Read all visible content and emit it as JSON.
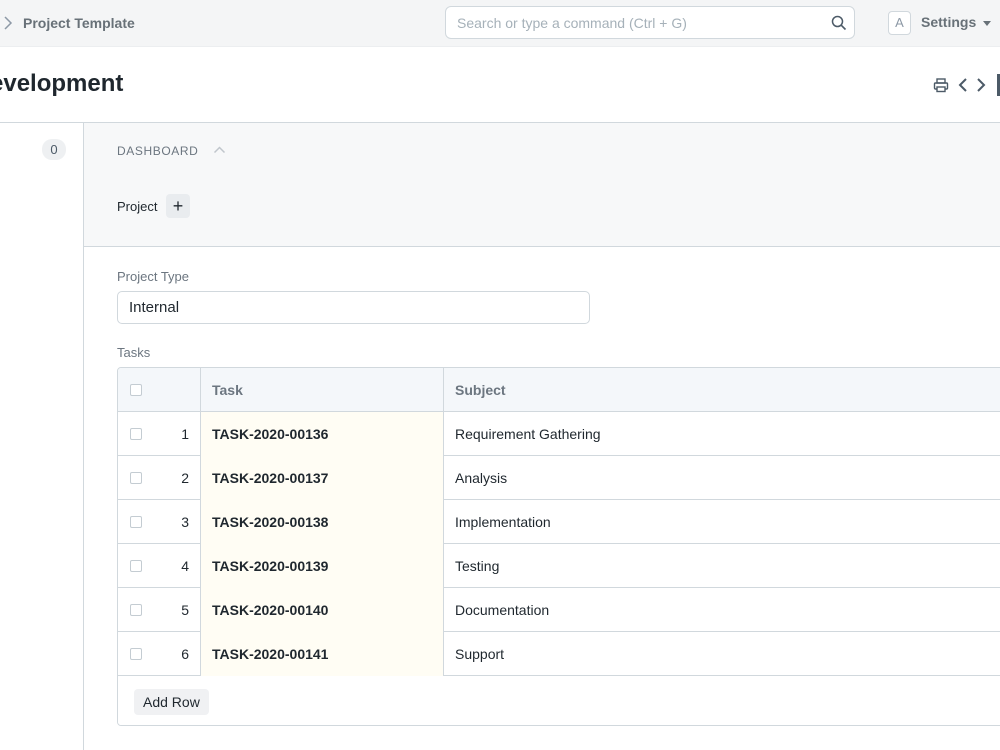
{
  "navbar": {
    "breadcrumb": "Project Template",
    "search_placeholder": "Search or type a command (Ctrl + G)",
    "avatar_initial": "A",
    "settings_label": "Settings"
  },
  "page": {
    "title": "evelopment"
  },
  "sidebar": {
    "badge_count": "0"
  },
  "dashboard": {
    "label": "DASHBOARD",
    "project_link": "Project",
    "add_symbol": "+"
  },
  "form": {
    "project_type_label": "Project Type",
    "project_type_value": "Internal",
    "tasks_label": "Tasks"
  },
  "grid": {
    "columns": [
      "Task",
      "Subject"
    ],
    "rows": [
      {
        "idx": "1",
        "task": "TASK-2020-00136",
        "subject": "Requirement Gathering"
      },
      {
        "idx": "2",
        "task": "TASK-2020-00137",
        "subject": "Analysis"
      },
      {
        "idx": "3",
        "task": "TASK-2020-00138",
        "subject": "Implementation"
      },
      {
        "idx": "4",
        "task": "TASK-2020-00139",
        "subject": "Testing"
      },
      {
        "idx": "5",
        "task": "TASK-2020-00140",
        "subject": "Documentation"
      },
      {
        "idx": "6",
        "task": "TASK-2020-00141",
        "subject": "Support"
      }
    ],
    "add_row_label": "Add Row"
  }
}
